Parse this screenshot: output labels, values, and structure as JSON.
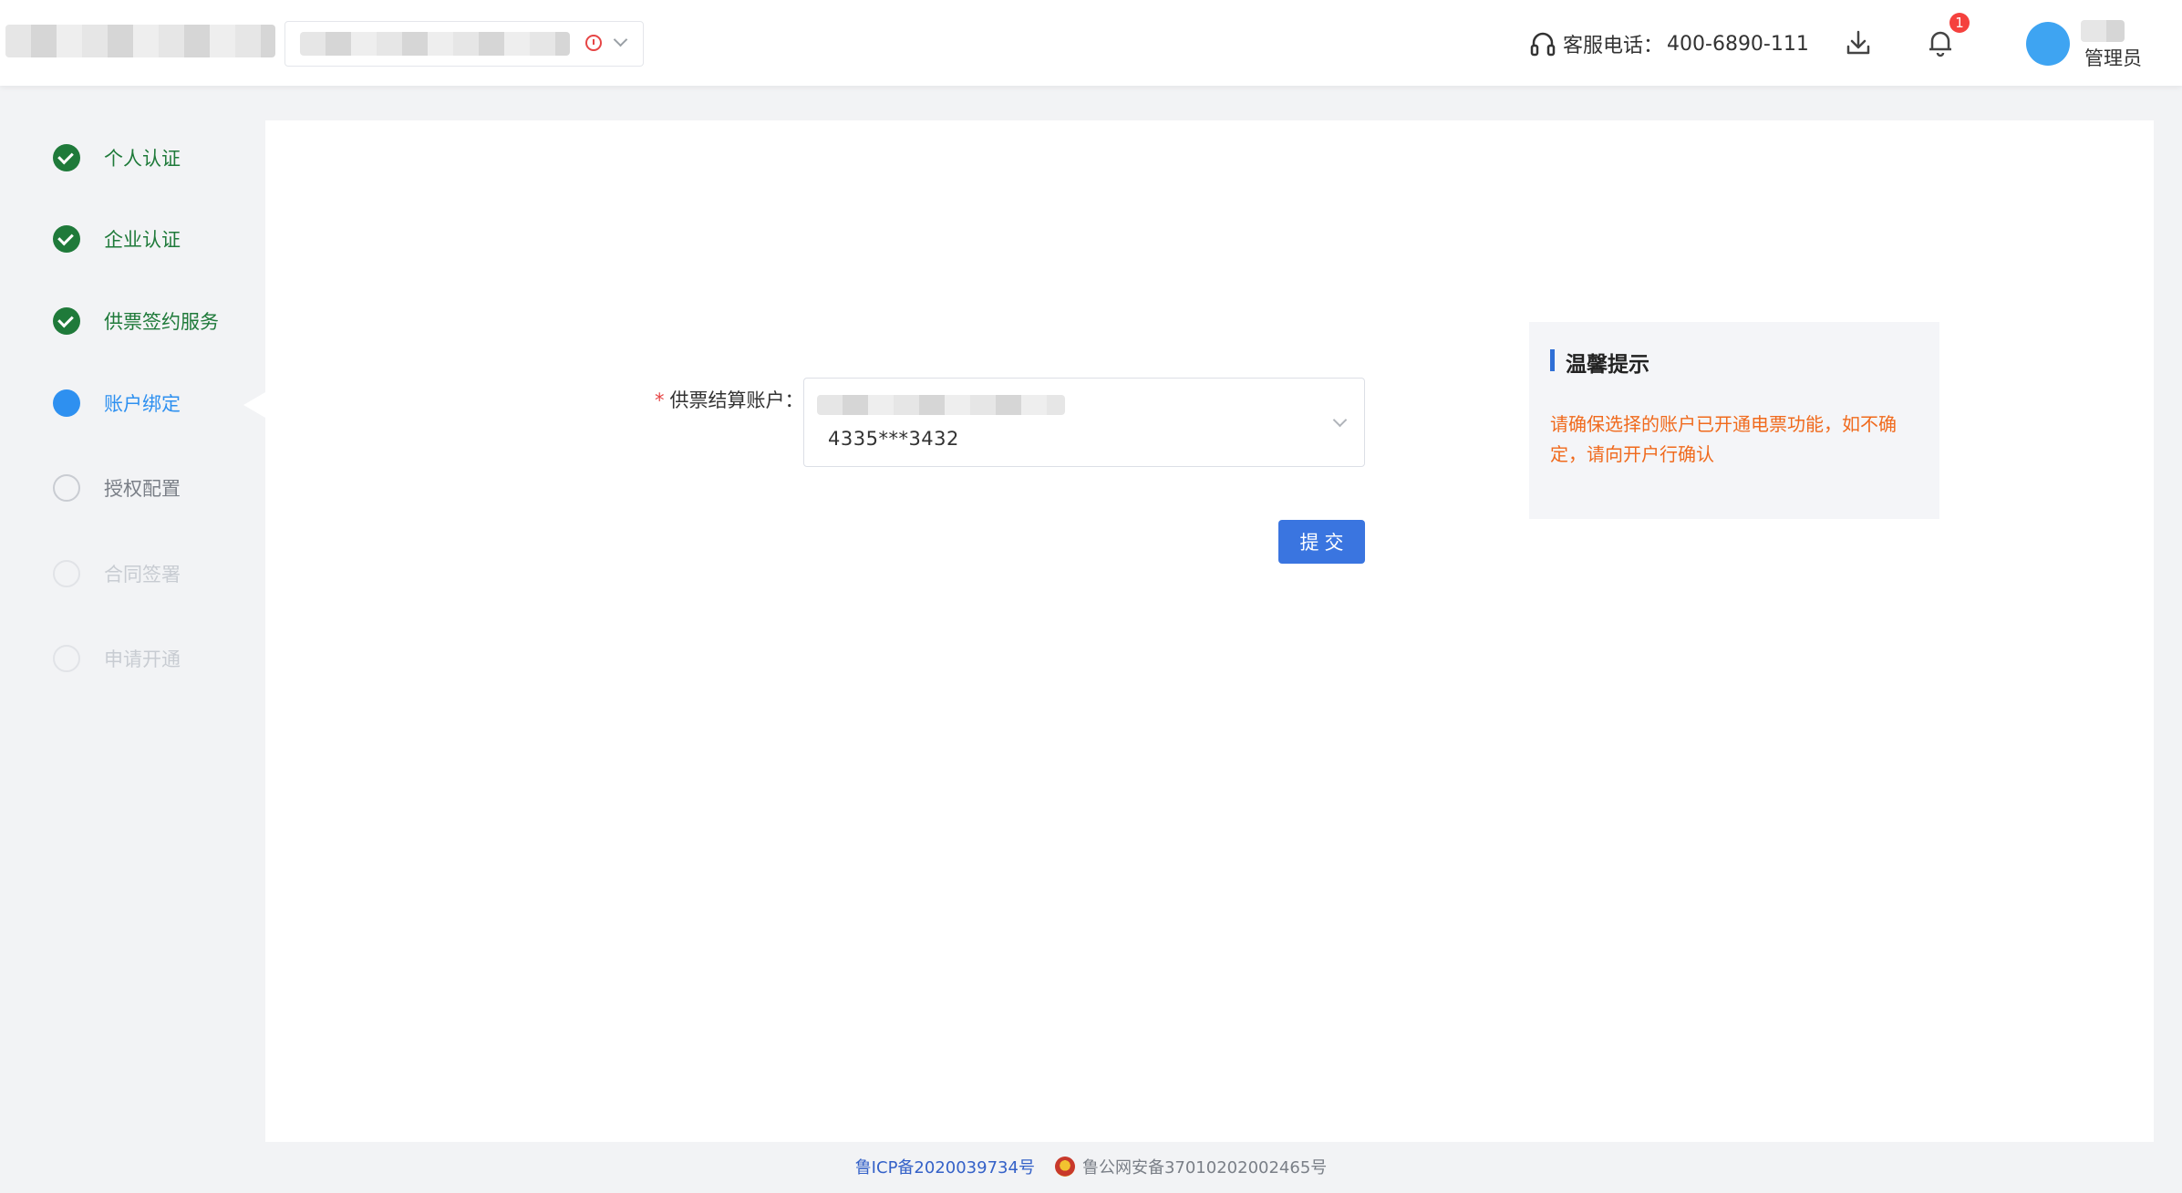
{
  "header": {
    "hotline_label": "客服电话：",
    "hotline_number": "400-6890-111",
    "notification_count": "1",
    "user_role": "管理员"
  },
  "steps": [
    {
      "label": "个人认证",
      "state": "done"
    },
    {
      "label": "企业认证",
      "state": "done"
    },
    {
      "label": "供票签约服务",
      "state": "done"
    },
    {
      "label": "账户绑定",
      "state": "active"
    },
    {
      "label": "授权配置",
      "state": "pending"
    },
    {
      "label": "合同签署",
      "state": "future"
    },
    {
      "label": "申请开通",
      "state": "future"
    }
  ],
  "form": {
    "required_mark": "*",
    "account_label": "供票结算账户：",
    "account_number": "4335***3432",
    "submit_label": "提交"
  },
  "tip": {
    "title": "温馨提示",
    "text": "请确保选择的账户已开通电票功能，如不确定，请向开户行确认"
  },
  "footer": {
    "icp": "鲁ICP备2020039734号",
    "police": "鲁公网安备37010202002465号"
  },
  "colors": {
    "done": "#1f7a3a",
    "active": "#2e90f0",
    "primary_button": "#3a75e0",
    "tip_text": "#f06a1d"
  }
}
